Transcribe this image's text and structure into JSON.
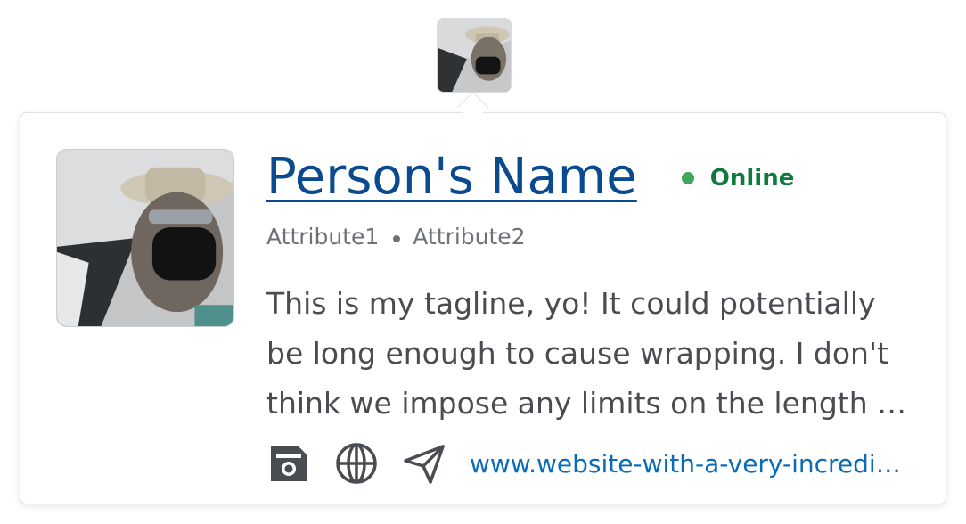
{
  "trigger": {
    "avatar_icon": "profile-photo"
  },
  "profile": {
    "name": "Person's Name",
    "status": "Online",
    "status_color": "#3fa85a",
    "attributes": [
      "Attribute1",
      "Attribute2"
    ],
    "tagline": "This is my tagline, yo! It could potentially be long enough to cause wrapping. I don't think we impose any limits on the length of this.",
    "website": "www.website-with-a-very-incredibly-long-url.com"
  },
  "links": {
    "save_icon": "save-icon",
    "globe_icon": "globe-icon",
    "send_icon": "send-icon"
  },
  "colors": {
    "name_link": "#0a4a8f",
    "status_text": "#0e7a3b",
    "website_link": "#0a6cb8"
  }
}
